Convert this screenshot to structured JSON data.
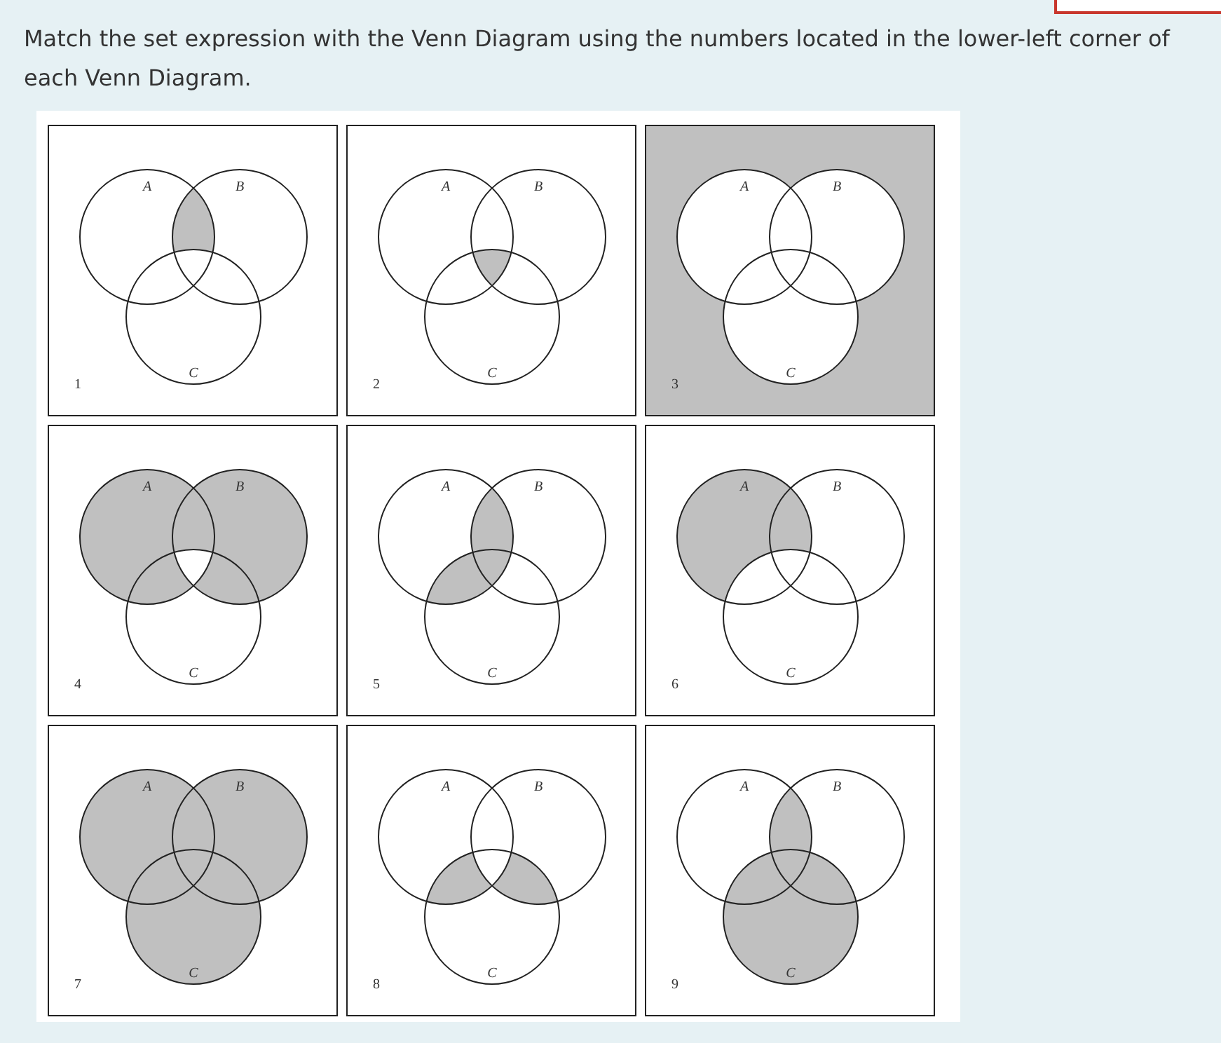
{
  "question": {
    "text": "Match the set expression with the Venn Diagram using the numbers located in the lower-left corner of each Venn Diagram."
  },
  "diagrams": [
    {
      "number": "1",
      "labels": [
        "A",
        "B",
        "C"
      ],
      "kind": "ab_without_c"
    },
    {
      "number": "2",
      "labels": [
        "A",
        "B",
        "C"
      ],
      "kind": "abc"
    },
    {
      "number": "3",
      "labels": [
        "A",
        "B",
        "C"
      ],
      "kind": "complement"
    },
    {
      "number": "4",
      "labels": [
        "A",
        "B",
        "C"
      ],
      "kind": "a_or_b_without_abc"
    },
    {
      "number": "5",
      "labels": [
        "A",
        "B",
        "C"
      ],
      "kind": "a_and_b_or_c"
    },
    {
      "number": "6",
      "labels": [
        "A",
        "B",
        "C"
      ],
      "kind": "a_without_c"
    },
    {
      "number": "7",
      "labels": [
        "A",
        "B",
        "C"
      ],
      "kind": "union"
    },
    {
      "number": "8",
      "labels": [
        "A",
        "B",
        "C"
      ],
      "kind": "c_pairs_without_abc"
    },
    {
      "number": "9",
      "labels": [
        "A",
        "B",
        "C"
      ],
      "kind": "c_or_ab"
    }
  ]
}
